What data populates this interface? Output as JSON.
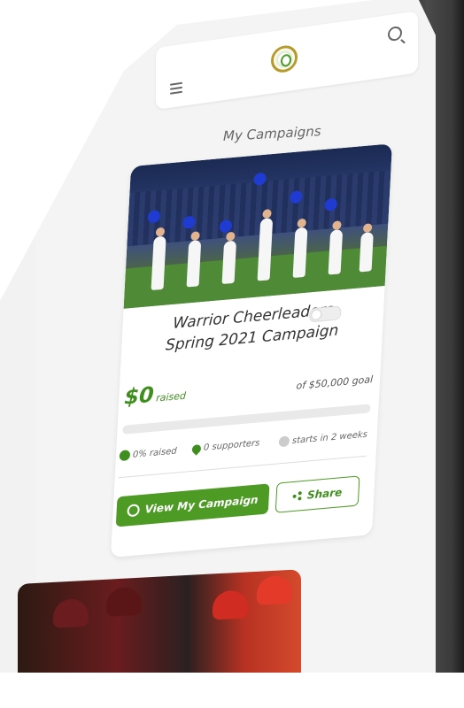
{
  "header": {
    "logo_alt": "logo",
    "menu_icon": "hamburger-icon",
    "search_icon": "search-icon"
  },
  "page_title": "My Campaigns",
  "campaign": {
    "title_line1": "Warrior Cheerleaders",
    "title_line2": "Spring 2021 Campaign",
    "raised_amount": "$0",
    "raised_label": "raised",
    "goal_text": "of $50,000 goal",
    "progress": 0,
    "stats": {
      "raised_pct": "0% raised",
      "supporters": "0 supporters",
      "starts": "starts in 2 weeks"
    },
    "view_button": "View My Campaign",
    "share_button": "Share"
  },
  "colors": {
    "accent": "#4d9a25",
    "text_green": "#3f8f1f",
    "frame": "#3a3a3a"
  }
}
